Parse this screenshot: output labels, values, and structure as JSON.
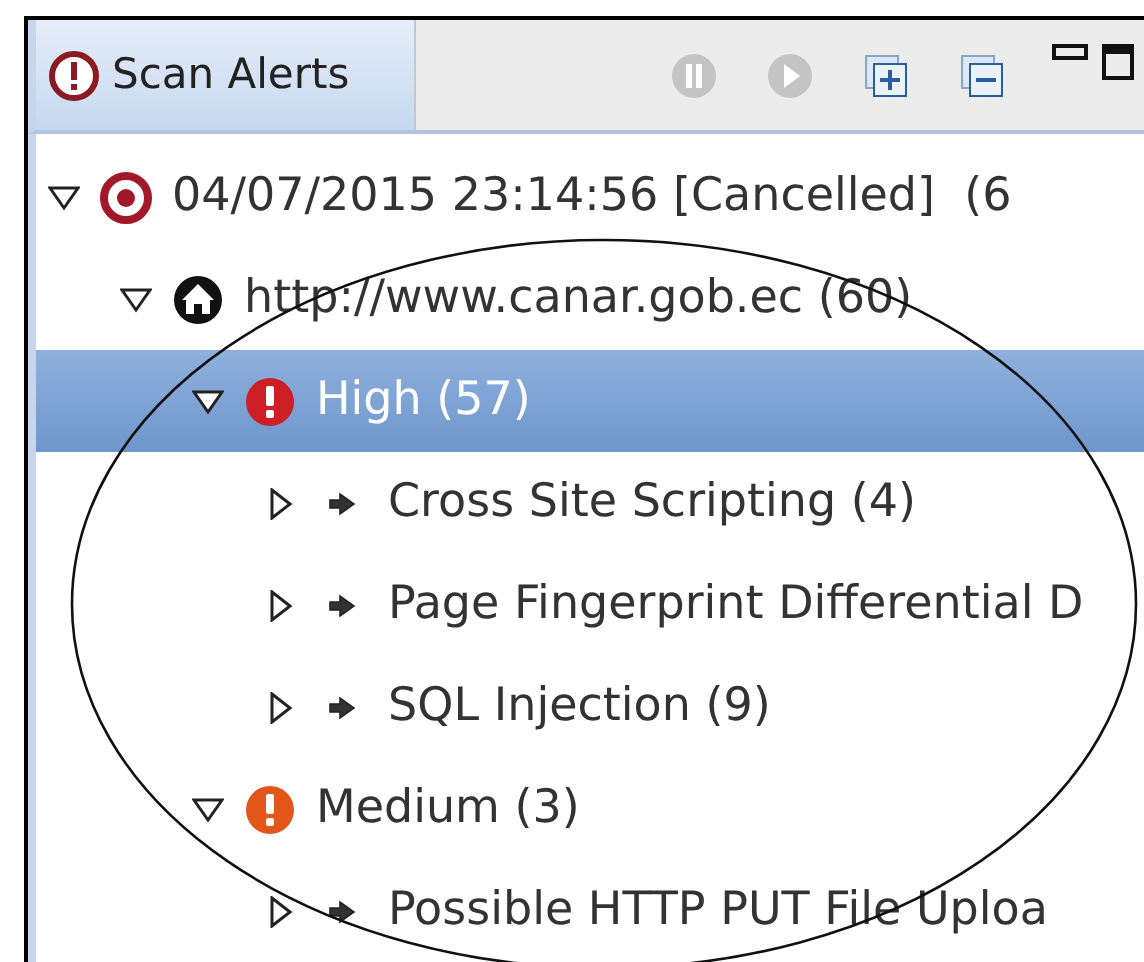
{
  "view": {
    "tab": {
      "title": "Scan Alerts",
      "selected": true
    },
    "toolbar": [
      {
        "kind": "pause",
        "disabled": true
      },
      {
        "kind": "play",
        "disabled": true
      },
      {
        "kind": "expand_all",
        "disabled": false
      },
      {
        "kind": "collapse_all",
        "disabled": false
      },
      {
        "kind": "minimize",
        "disabled": false
      },
      {
        "kind": "maximize",
        "disabled": false
      }
    ]
  },
  "tree": [
    {
      "kind": "scan",
      "label": "04/07/2015 23:14:56 [Cancelled]  (6",
      "expanded": true,
      "selected": false,
      "children": [
        {
          "kind": "site",
          "label": "http://www.canar.gob.ec (60)",
          "expanded": true,
          "selected": false,
          "children": [
            {
              "kind": "risk",
              "label": "High (57)",
              "color": "#cc1f26",
              "expanded": true,
              "selected": true,
              "children": [
                {
                  "kind": "alert",
                  "label": "Cross Site Scripting (4)",
                  "expanded": false,
                  "selected": false
                },
                {
                  "kind": "alert",
                  "label": "Page Fingerprint Differential D",
                  "expanded": false,
                  "selected": false
                },
                {
                  "kind": "alert",
                  "label": "SQL Injection (9)",
                  "expanded": false,
                  "selected": false
                }
              ]
            },
            {
              "kind": "risk",
              "label": "Medium (3)",
              "color": "#e2561a",
              "expanded": true,
              "selected": false,
              "children": [
                {
                  "kind": "alert",
                  "label": "Possible HTTP PUT File Uploa",
                  "expanded": false,
                  "selected": false
                }
              ]
            }
          ]
        }
      ]
    }
  ],
  "annotation": {
    "kind": "ellipse"
  }
}
